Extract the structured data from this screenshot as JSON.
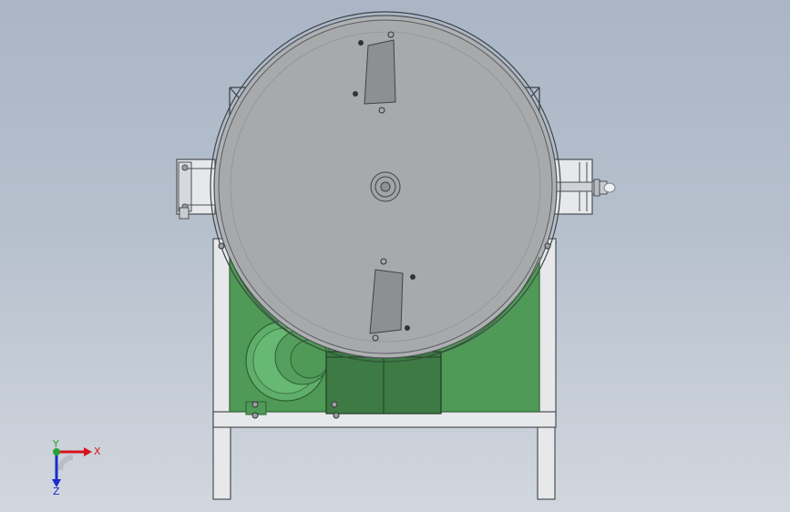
{
  "viewport": {
    "background_top": "#aab6c6",
    "background_bottom": "#d2d7de"
  },
  "model": {
    "frame_color": "#e6e8ea",
    "frame_stroke": "#4a4f55",
    "panel_color": "#4f9a56",
    "drum_face_color": "#a7a9ab",
    "housing_color": "#3e7a44"
  },
  "triad": {
    "x_label": "X",
    "y_label": "Y",
    "z_label": "Z",
    "x_color": "#d8141b",
    "y_color": "#2aa236",
    "z_color": "#1a2ccc"
  }
}
